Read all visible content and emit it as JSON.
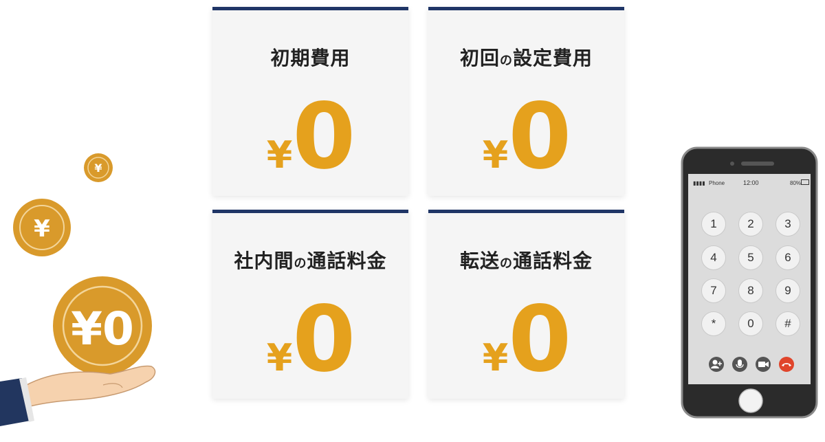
{
  "cards": [
    {
      "title": "初期費用",
      "currency": "¥",
      "amount": "0"
    },
    {
      "title_a": "初回",
      "title_b": "の",
      "title_c": "設定費用",
      "currency": "¥",
      "amount": "0"
    },
    {
      "title_a": "社内間",
      "title_b": "の",
      "title_c": "通話料金",
      "currency": "¥",
      "amount": "0"
    },
    {
      "title_a": "転送",
      "title_b": "の",
      "title_c": "通話料金",
      "currency": "¥",
      "amount": "0"
    }
  ],
  "coins": {
    "small": "¥",
    "medium": "¥",
    "large": "¥0"
  },
  "phone": {
    "carrier": "Phone",
    "time": "12:00",
    "battery": "80%",
    "keys": [
      "1",
      "2",
      "3",
      "4",
      "5",
      "6",
      "7",
      "8",
      "9",
      "*",
      "0",
      "#"
    ]
  },
  "colors": {
    "accent": "#e5a11d",
    "card_border": "#1f3566",
    "coin": "#d99a2b"
  }
}
